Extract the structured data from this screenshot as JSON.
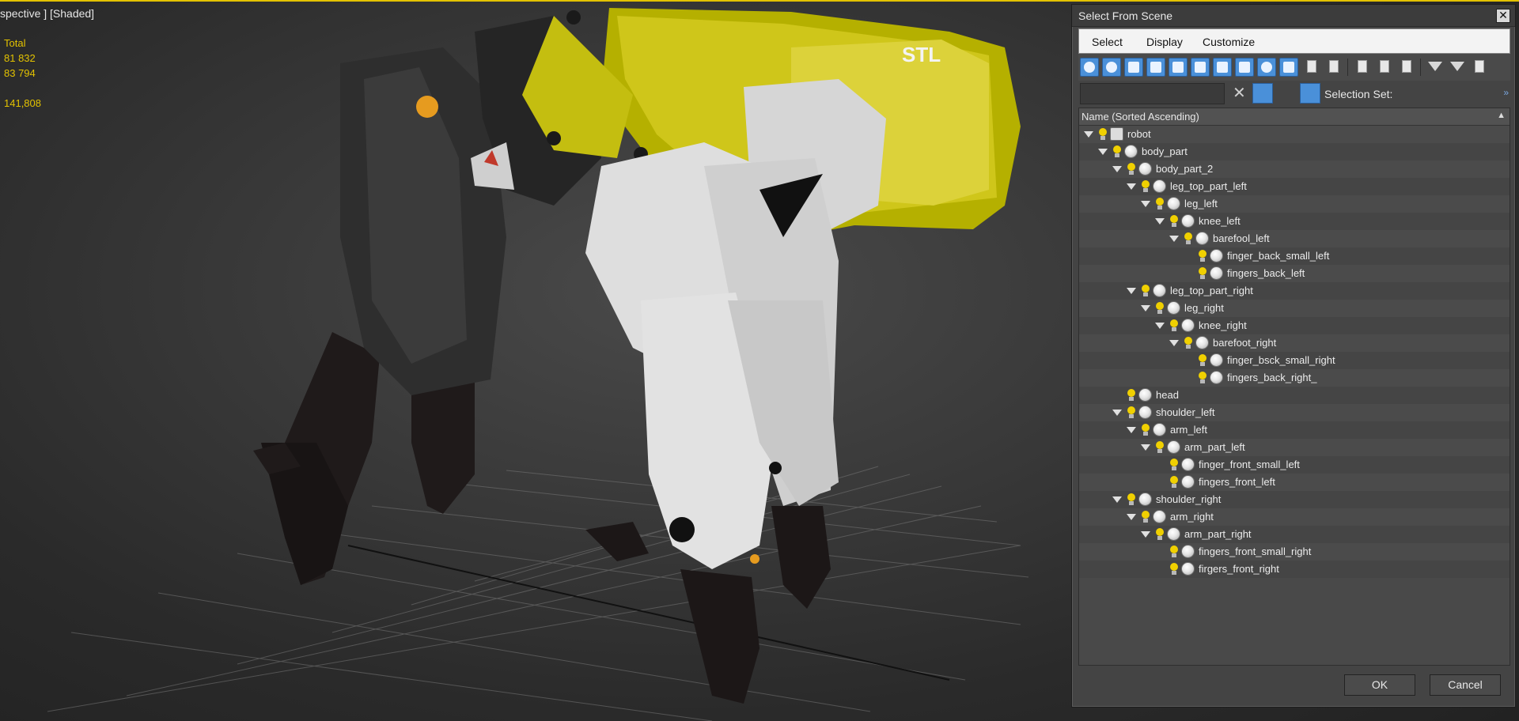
{
  "viewport": {
    "label": "spective ] [Shaded]",
    "stats": {
      "total_label": "Total",
      "value_1": "81 832",
      "value_2": "83 794",
      "value_3": "141,808"
    },
    "model_logo_text": "STL"
  },
  "dialog": {
    "title": "Select From Scene",
    "close_glyph": "✕",
    "menu": [
      "Select",
      "Display",
      "Customize"
    ],
    "search": {
      "value": "",
      "clear_glyph": "✕"
    },
    "selection_set_label": "Selection Set:",
    "more_glyph": "»",
    "list_header": "Name (Sorted Ascending)",
    "sort_glyph": "▲",
    "tree": [
      {
        "label": "robot",
        "depth": 0,
        "expanded": true,
        "type": "group"
      },
      {
        "label": "body_part",
        "depth": 1,
        "expanded": true,
        "type": "mesh"
      },
      {
        "label": "body_part_2",
        "depth": 2,
        "expanded": true,
        "type": "mesh"
      },
      {
        "label": "leg_top_part_left",
        "depth": 3,
        "expanded": true,
        "type": "mesh"
      },
      {
        "label": "leg_left",
        "depth": 4,
        "expanded": true,
        "type": "mesh"
      },
      {
        "label": "knee_left",
        "depth": 5,
        "expanded": true,
        "type": "mesh"
      },
      {
        "label": "barefool_left",
        "depth": 6,
        "expanded": true,
        "type": "mesh"
      },
      {
        "label": "finger_back_small_left",
        "depth": 7,
        "expanded": false,
        "type": "mesh"
      },
      {
        "label": "fingers_back_left",
        "depth": 7,
        "expanded": false,
        "type": "mesh"
      },
      {
        "label": "leg_top_part_right",
        "depth": 3,
        "expanded": true,
        "type": "mesh"
      },
      {
        "label": "leg_right",
        "depth": 4,
        "expanded": true,
        "type": "mesh"
      },
      {
        "label": "knee_right",
        "depth": 5,
        "expanded": true,
        "type": "mesh"
      },
      {
        "label": "barefoot_right",
        "depth": 6,
        "expanded": true,
        "type": "mesh"
      },
      {
        "label": "finger_bsck_small_right",
        "depth": 7,
        "expanded": false,
        "type": "mesh"
      },
      {
        "label": "fingers_back_right_",
        "depth": 7,
        "expanded": false,
        "type": "mesh"
      },
      {
        "label": "head",
        "depth": 2,
        "expanded": false,
        "type": "mesh"
      },
      {
        "label": "shoulder_left",
        "depth": 2,
        "expanded": true,
        "type": "mesh"
      },
      {
        "label": "arm_left",
        "depth": 3,
        "expanded": true,
        "type": "mesh"
      },
      {
        "label": "arm_part_left",
        "depth": 4,
        "expanded": true,
        "type": "mesh"
      },
      {
        "label": "finger_front_small_left",
        "depth": 5,
        "expanded": false,
        "type": "mesh"
      },
      {
        "label": "fingers_front_left",
        "depth": 5,
        "expanded": false,
        "type": "mesh"
      },
      {
        "label": "shoulder_right",
        "depth": 2,
        "expanded": true,
        "type": "mesh"
      },
      {
        "label": "arm_right",
        "depth": 3,
        "expanded": true,
        "type": "mesh"
      },
      {
        "label": "arm_part_right",
        "depth": 4,
        "expanded": true,
        "type": "mesh"
      },
      {
        "label": "fingers_front_small_right",
        "depth": 5,
        "expanded": false,
        "type": "mesh"
      },
      {
        "label": "firgers_front_right",
        "depth": 5,
        "expanded": false,
        "type": "mesh"
      }
    ],
    "ok_label": "OK",
    "cancel_label": "Cancel"
  },
  "colors": {
    "accent_yellow": "#e3c200",
    "selection_blue": "#4a90d9",
    "panel_bg": "#444444",
    "viewport_bg": "#3a3a3a"
  },
  "icons": {
    "visibility": "lightbulb-icon",
    "object": "sphere-object-icon",
    "group": "group-icon",
    "expand": "expand-triangle-icon"
  }
}
